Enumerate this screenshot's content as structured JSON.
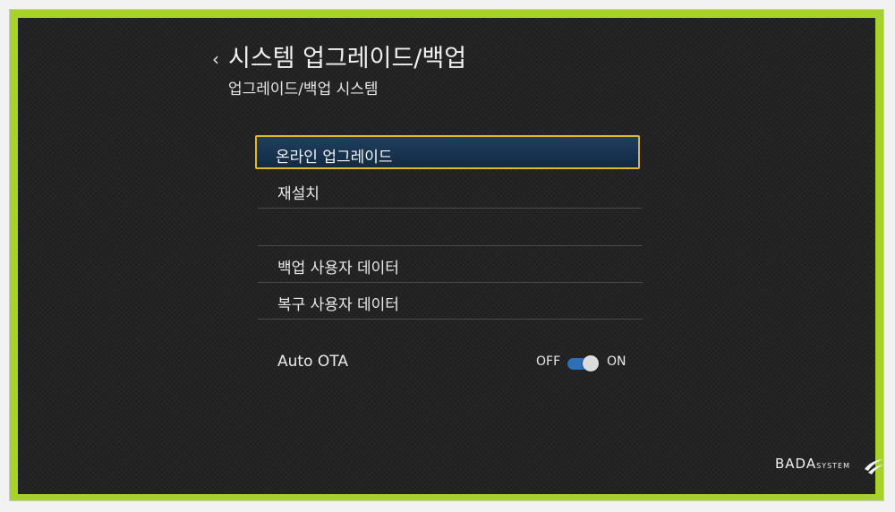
{
  "header": {
    "back_glyph": "‹",
    "title": "시스템 업그레이드/백업",
    "subtitle": "업그레이드/백업 시스템"
  },
  "menu": {
    "items": [
      {
        "label": "온라인 업그레이드",
        "selected": true
      },
      {
        "label": "재설치"
      },
      {
        "label": ""
      },
      {
        "label": "백업 사용자 데이터"
      },
      {
        "label": "복구 사용자 데이터"
      }
    ]
  },
  "auto_ota": {
    "label": "Auto OTA",
    "off_label": "OFF",
    "on_label": "ON",
    "state": "on"
  },
  "brand": {
    "name_main": "BADA",
    "name_sub": "SYSTEM"
  },
  "colors": {
    "frame": "#a6d22a",
    "screen_bg": "#232323",
    "selection_border": "#e2b72a",
    "selection_fill": "#1f3f5f",
    "toggle_on": "#2e6fb5"
  }
}
